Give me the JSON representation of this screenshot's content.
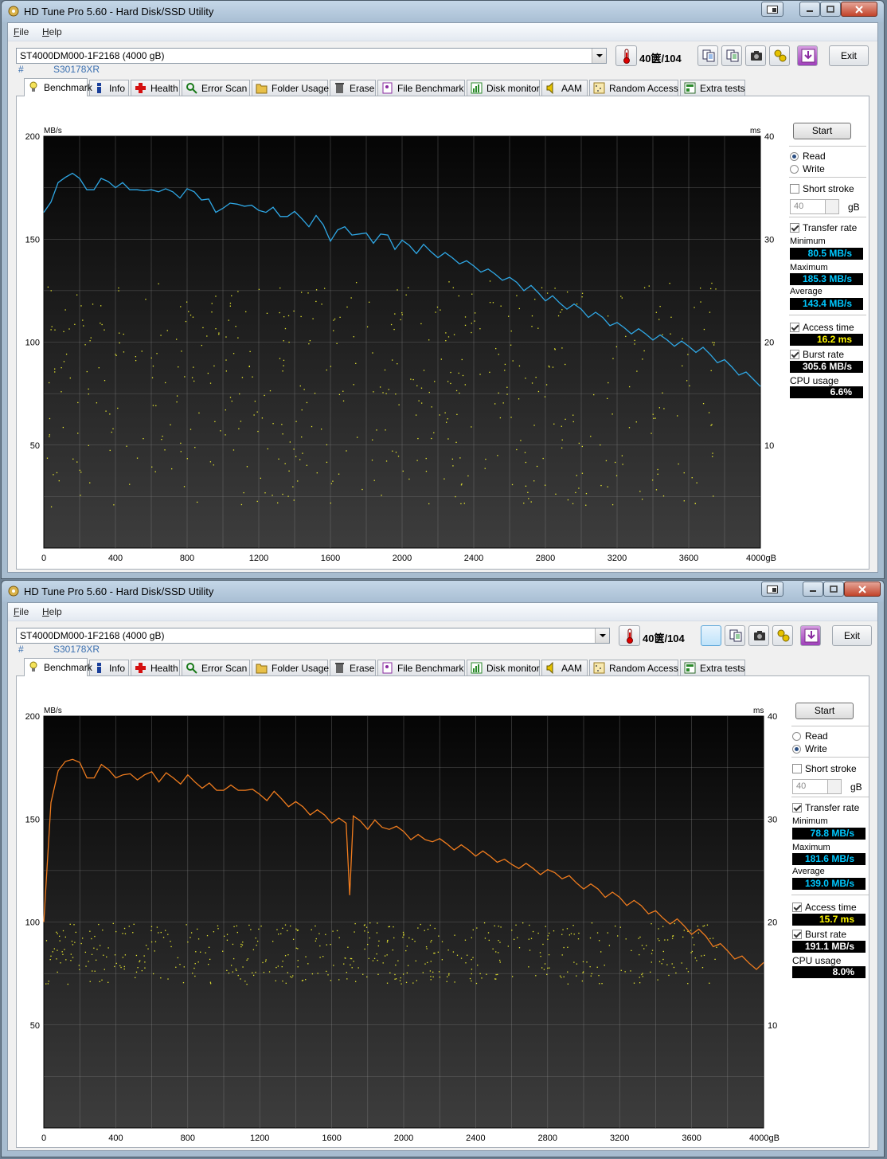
{
  "window_title": "HD Tune Pro 5.60 - Hard Disk/SSD Utility",
  "menu": {
    "file": "File",
    "help": "Help"
  },
  "drive": {
    "name": "ST4000DM000-1F2168 (4000 gB)",
    "serial_hash": "#",
    "serial": "S30178XR"
  },
  "temperature": "40°C/104",
  "temperature_shown": "40箧/104",
  "exit_label": "Exit",
  "tabs": [
    "Benchmark",
    "Info",
    "Health",
    "Error Scan",
    "Folder Usage",
    "Erase",
    "File Benchmark",
    "Disk monitor",
    "AAM",
    "Random Access",
    "Extra tests"
  ],
  "sidebar": {
    "start": "Start",
    "read": "Read",
    "write": "Write",
    "short_stroke": "Short stroke",
    "short_stroke_value": "40",
    "short_stroke_unit": "gB",
    "transfer_rate": "Transfer rate",
    "minimum": "Minimum",
    "maximum": "Maximum",
    "average": "Average",
    "access_time": "Access time",
    "burst_rate": "Burst rate",
    "cpu_usage": "CPU usage"
  },
  "read_results": {
    "minimum": "80.5 MB/s",
    "maximum": "185.3 MB/s",
    "average": "143.4 MB/s",
    "access_time": "16.2 ms",
    "burst_rate": "305.6 MB/s",
    "cpu_usage": "6.6%"
  },
  "write_results": {
    "minimum": "78.8 MB/s",
    "maximum": "181.6 MB/s",
    "average": "139.0 MB/s",
    "access_time": "15.7 ms",
    "burst_rate": "191.1 MB/s",
    "cpu_usage": "8.0%"
  },
  "colors": {
    "read_line": "#2fa8e6",
    "write_line": "#f07c1e",
    "access_dots": "#e8e830",
    "value_text": "#00c8ff",
    "access_value": "#fff800"
  },
  "chart_data": [
    {
      "type": "line",
      "mode": "Read",
      "xlabel": "gB",
      "ylabel": "MB/s",
      "y2label": "ms",
      "xlim": [
        0,
        4000
      ],
      "ylim": [
        0,
        200
      ],
      "y2lim": [
        0,
        40
      ],
      "x_ticks": [
        "0",
        "400",
        "800",
        "1200",
        "1600",
        "2000",
        "2400",
        "2800",
        "3200",
        "3600",
        "4000gB"
      ],
      "y_ticks": [
        "200",
        "150",
        "100",
        "50"
      ],
      "y2_ticks": [
        "40",
        "30",
        "20",
        "10"
      ],
      "grid": true,
      "series": [
        {
          "kind": "transfer_rate",
          "x": [
            0,
            40,
            80,
            120,
            160,
            200,
            240,
            280,
            320,
            360,
            400,
            440,
            480,
            520,
            560,
            600,
            640,
            680,
            720,
            760,
            800,
            840,
            880,
            920,
            960,
            1000,
            1040,
            1080,
            1120,
            1160,
            1200,
            1240,
            1280,
            1320,
            1360,
            1400,
            1440,
            1480,
            1520,
            1560,
            1600,
            1640,
            1680,
            1720,
            1760,
            1800,
            1840,
            1880,
            1920,
            1960,
            2000,
            2040,
            2080,
            2120,
            2160,
            2200,
            2240,
            2280,
            2320,
            2360,
            2400,
            2440,
            2480,
            2520,
            2560,
            2600,
            2640,
            2680,
            2720,
            2760,
            2800,
            2840,
            2880,
            2920,
            2960,
            3000,
            3040,
            3080,
            3120,
            3160,
            3200,
            3240,
            3280,
            3320,
            3360,
            3400,
            3440,
            3480,
            3520,
            3560,
            3600,
            3640,
            3680,
            3720,
            3760,
            3800,
            3840,
            3880,
            3920,
            3960,
            4000
          ],
          "y": [
            163,
            170,
            176,
            180,
            184,
            178,
            174,
            176,
            178,
            178,
            177,
            176,
            174,
            176,
            172,
            174,
            175,
            173,
            173,
            172,
            173,
            173,
            171,
            168,
            163,
            167,
            166,
            167,
            168,
            165,
            164,
            165,
            164,
            161,
            163,
            162,
            160,
            158,
            160,
            157,
            151,
            153,
            156,
            154,
            151,
            153,
            150,
            151,
            152,
            147,
            148,
            147,
            145,
            146,
            144,
            143,
            142,
            141,
            140,
            138,
            137,
            136,
            134,
            133,
            132,
            130,
            129,
            127,
            126,
            124,
            122,
            121,
            119,
            118,
            117,
            116,
            114,
            113,
            112,
            110,
            108,
            107,
            106,
            105,
            104,
            103,
            102,
            101,
            100,
            99,
            98,
            97,
            96,
            94,
            92,
            90,
            88,
            86,
            84,
            82,
            80.5
          ]
        },
        {
          "kind": "access_time",
          "display": "scatter",
          "unit": "ms",
          "range": [
            4,
            26
          ]
        }
      ]
    },
    {
      "type": "line",
      "mode": "Write",
      "xlabel": "gB",
      "ylabel": "MB/s",
      "y2label": "ms",
      "xlim": [
        0,
        4000
      ],
      "ylim": [
        0,
        200
      ],
      "y2lim": [
        0,
        40
      ],
      "x_ticks": [
        "0",
        "400",
        "800",
        "1200",
        "1600",
        "2000",
        "2400",
        "2800",
        "3200",
        "3600",
        "4000gB"
      ],
      "y_ticks": [
        "200",
        "150",
        "100",
        "50"
      ],
      "y2_ticks": [
        "40",
        "30",
        "20",
        "10"
      ],
      "grid": true,
      "series": [
        {
          "kind": "transfer_rate",
          "x": [
            0,
            40,
            80,
            120,
            160,
            200,
            240,
            280,
            320,
            360,
            400,
            440,
            480,
            520,
            560,
            600,
            640,
            680,
            720,
            760,
            800,
            840,
            880,
            920,
            960,
            1000,
            1040,
            1080,
            1120,
            1160,
            1200,
            1240,
            1280,
            1320,
            1360,
            1400,
            1440,
            1480,
            1520,
            1560,
            1600,
            1640,
            1680,
            1700,
            1720,
            1760,
            1800,
            1840,
            1880,
            1920,
            1960,
            2000,
            2040,
            2080,
            2120,
            2160,
            2200,
            2240,
            2280,
            2320,
            2360,
            2400,
            2440,
            2480,
            2520,
            2560,
            2600,
            2640,
            2680,
            2720,
            2760,
            2800,
            2840,
            2880,
            2920,
            2960,
            3000,
            3040,
            3080,
            3120,
            3160,
            3200,
            3240,
            3280,
            3320,
            3360,
            3400,
            3440,
            3480,
            3520,
            3560,
            3600,
            3640,
            3680,
            3720,
            3760,
            3800,
            3840,
            3880,
            3920,
            3960,
            4000
          ],
          "y": [
            100,
            160,
            172,
            178,
            181,
            176,
            170,
            172,
            175,
            174,
            172,
            170,
            172,
            171,
            170,
            173,
            170,
            171,
            170,
            169,
            170,
            168,
            167,
            166,
            164,
            166,
            165,
            164,
            166,
            163,
            162,
            161,
            162,
            160,
            158,
            157,
            156,
            154,
            153,
            152,
            150,
            149,
            148,
            115,
            150,
            149,
            147,
            148,
            146,
            147,
            145,
            144,
            142,
            141,
            140,
            141,
            139,
            138,
            137,
            136,
            135,
            134,
            133,
            132,
            131,
            129,
            128,
            128,
            127,
            126,
            125,
            124,
            124,
            123,
            121,
            119,
            118,
            117,
            116,
            114,
            113,
            112,
            110,
            109,
            108,
            106,
            104,
            102,
            101,
            100,
            98,
            96,
            95,
            93,
            90,
            88,
            86,
            84,
            82,
            80,
            79,
            78.8
          ]
        },
        {
          "kind": "access_time",
          "display": "scatter",
          "unit": "ms",
          "range": [
            14,
            20
          ]
        }
      ]
    }
  ]
}
